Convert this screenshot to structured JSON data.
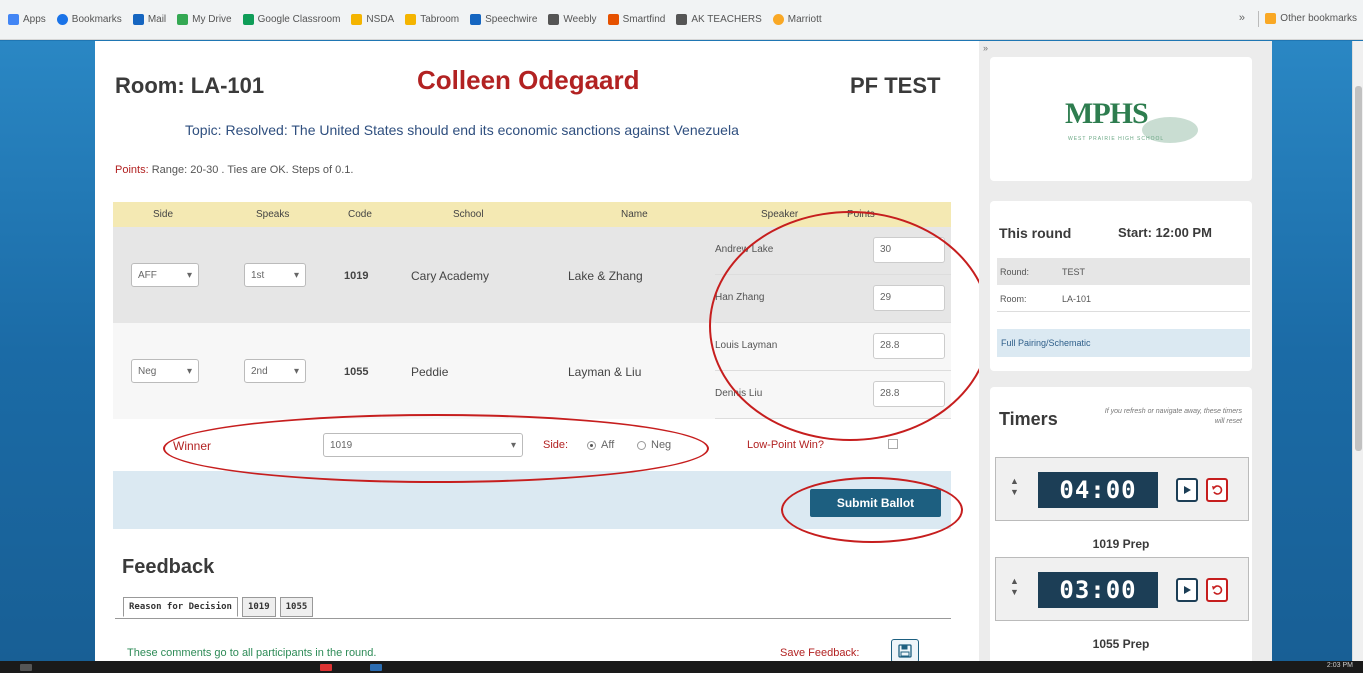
{
  "bookmarks": {
    "items": [
      "Apps",
      "Bookmarks",
      "Mail",
      "My Drive",
      "Google Classroom",
      "NSDA",
      "Tabroom",
      "Speechwire",
      "Weebly",
      "Smartfind",
      "AK TEACHERS",
      "Marriott"
    ],
    "other": "Other bookmarks",
    "colors": [
      "#4285f4",
      "#1a73e8",
      "#1565c0",
      "#34a853",
      "#0f9d58",
      "#f4b400",
      "#f4b400",
      "#1565c0",
      "#555555",
      "#e65100",
      "#555555",
      "#f9a825"
    ]
  },
  "ballot": {
    "room": "Room: LA-101",
    "judge": "Colleen Odegaard",
    "event": "PF TEST",
    "topic": "Topic: Resolved: The United States should end its economic sanctions against Venezuela",
    "points_label": "Points:",
    "points_rule": "Range: 20-30 . Ties are OK. Steps of 0.1.",
    "headers": {
      "side": "Side",
      "speaks": "Speaks",
      "code": "Code",
      "school": "School",
      "name": "Name",
      "speaker": "Speaker",
      "points": "Points"
    },
    "rows": [
      {
        "side": "AFF",
        "speaks": "1st",
        "code": "1019",
        "school": "Cary Academy",
        "name": "Lake & Zhang",
        "speakers": [
          {
            "name": "Andrew Lake",
            "points": "30"
          },
          {
            "name": "Han Zhang",
            "points": "29"
          }
        ]
      },
      {
        "side": "Neg",
        "speaks": "2nd",
        "code": "1055",
        "school": "Peddie",
        "name": "Layman & Liu",
        "speakers": [
          {
            "name": "Louis Layman",
            "points": "28.8"
          },
          {
            "name": "Dennis Liu",
            "points": "28.8"
          }
        ]
      }
    ],
    "winner_label": "Winner",
    "winner_value": "1019",
    "side_label": "Side:",
    "aff_label": "Aff",
    "neg_label": "Neg",
    "lowpoint_label": "Low-Point Win?",
    "submit_label": "Submit Ballot"
  },
  "feedback": {
    "title": "Feedback",
    "tabs": [
      "Reason for Decision",
      "1019",
      "1055"
    ],
    "note": "These comments go to all participants in the round.",
    "save_label": "Save Feedback:"
  },
  "sidebar": {
    "toggle": "»",
    "logo": "MPHS",
    "logo_sub": "WEST PRAIRIE HIGH SCHOOL",
    "round_title": "This round",
    "start": "Start: 12:00 PM",
    "round_key": "Round:",
    "round_value": "TEST",
    "room_key": "Room:",
    "room_value": "LA-101",
    "schematic": "Full Pairing/Schematic",
    "timers_title": "Timers",
    "timers_note": "If you refresh or navigate away, these timers will reset",
    "timers": [
      {
        "time": "04:00",
        "label": "1019 Prep"
      },
      {
        "time": "03:00",
        "label": "1055 Prep"
      }
    ]
  },
  "taskbar": {
    "time": "2:03 PM"
  }
}
